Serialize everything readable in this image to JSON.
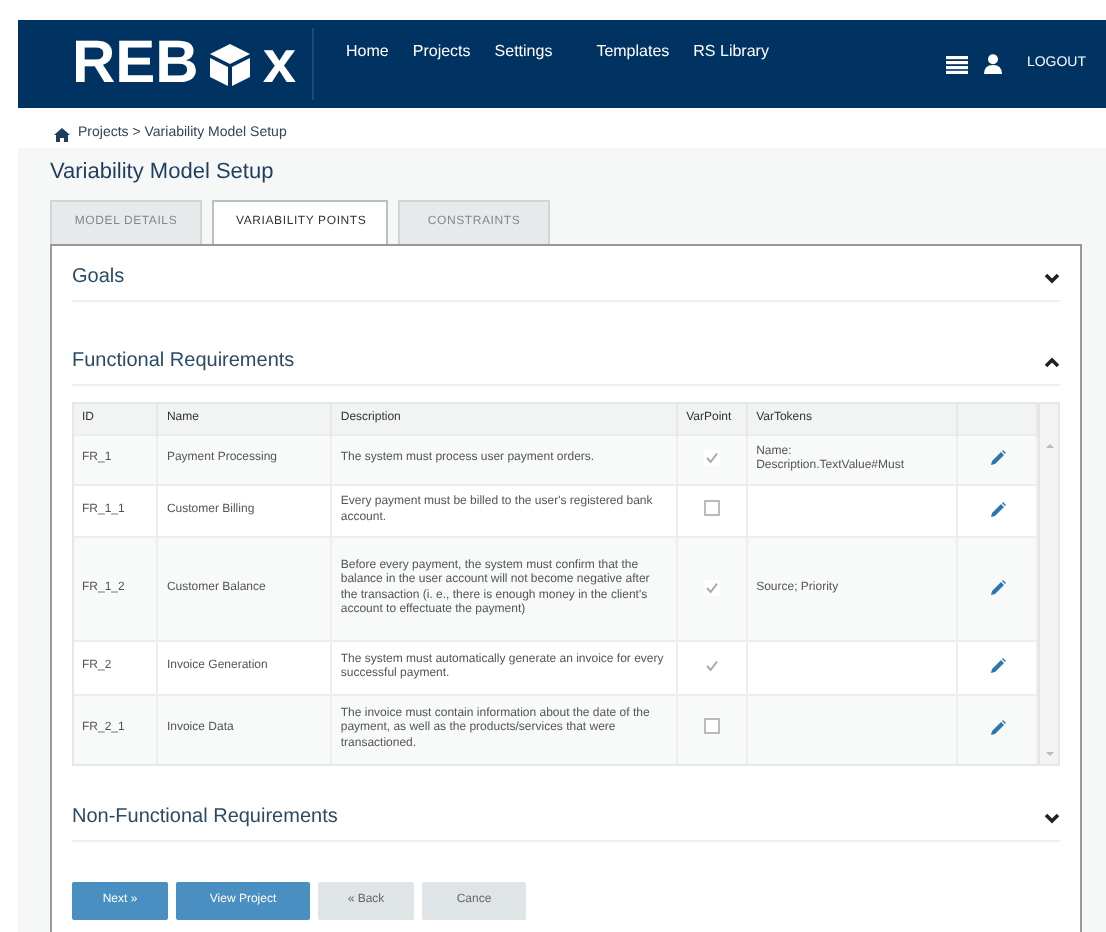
{
  "navbar": {
    "logo_left": "REB",
    "logo_right": "x",
    "links": [
      "Home",
      "Projects",
      "Settings",
      "Templates",
      "RS Library"
    ],
    "logout": "LOGOUT"
  },
  "breadcrumb": "Projects > Variability Model Setup",
  "page_title": "Variability Model Setup",
  "tabs": [
    {
      "label": "MODEL DETAILS",
      "selected": false
    },
    {
      "label": "VARIABILITY POINTS",
      "selected": true
    },
    {
      "label": "CONSTRAINTS",
      "selected": false
    }
  ],
  "sections": [
    {
      "title": "Goals",
      "expanded": false
    },
    {
      "title": "Functional Requirements",
      "expanded": true
    },
    {
      "title": "Non-Functional Requirements",
      "expanded": false
    }
  ],
  "table": {
    "columns": [
      "ID",
      "Name",
      "Description",
      "VarPoint",
      "VarTokens"
    ],
    "rows": [
      {
        "id": "FR_1",
        "name": "Payment Processing",
        "description": "The system must process user payment orders.",
        "varpoint": true,
        "vartokens": [
          "Name:",
          "Description.TextValue#Must"
        ]
      },
      {
        "id": "FR_1_1",
        "name": "Customer Billing",
        "description": "Every payment must be billed to the user's registered bank account.",
        "varpoint": false,
        "vartokens": []
      },
      {
        "id": "FR_1_2",
        "name": "Customer Balance",
        "description": "Before every payment, the system must confirm that the balance in the user account will not become negative after the transaction (i. e., there is enough money in the client's account to effectuate the payment)",
        "varpoint": true,
        "vartokens": [
          "Source; Priority"
        ]
      },
      {
        "id": "FR_2",
        "name": "Invoice Generation",
        "description": "The system must automatically generate an invoice for every successful payment.",
        "varpoint": true,
        "vartokens": []
      },
      {
        "id": "FR_2_1",
        "name": "Invoice Data",
        "description": "The invoice must contain information about the date of the payment, as well as the products/services that were transactioned.",
        "varpoint": false,
        "vartokens": []
      }
    ]
  },
  "buttons": [
    {
      "label": "Next »",
      "kind": "primary"
    },
    {
      "label": "View Project",
      "kind": "primary"
    },
    {
      "label": "« Back",
      "kind": "secondary"
    },
    {
      "label": "Cance",
      "kind": "secondary"
    }
  ]
}
